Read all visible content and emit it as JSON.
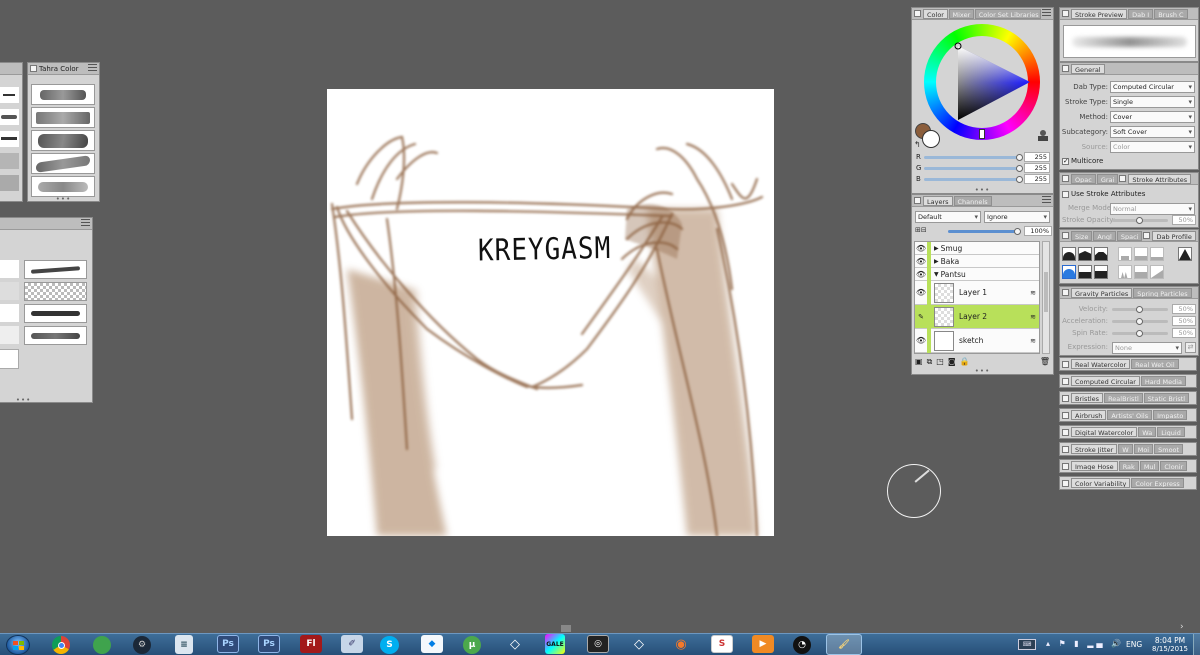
{
  "left_panels": {
    "palette_title": "Tahra Color"
  },
  "canvas": {
    "sketch_text": "KREYGASM"
  },
  "color_panel": {
    "tabs": [
      "Color",
      "Mixer",
      "Color Set Libraries"
    ],
    "rgb": [
      {
        "label": "R",
        "value": "255"
      },
      {
        "label": "G",
        "value": "255"
      },
      {
        "label": "B",
        "value": "255"
      }
    ],
    "current_color": "#8b5e3c",
    "secondary_color": "#ffffff"
  },
  "layers_panel": {
    "tabs": [
      "Layers",
      "Channels"
    ],
    "blend_mode": "Default",
    "lock_mode": "Ignore",
    "opacity": "100%",
    "groups": [
      {
        "name": "Smug",
        "expanded": false
      },
      {
        "name": "Baka",
        "expanded": false
      },
      {
        "name": "Pantsu",
        "expanded": true
      }
    ],
    "layers": [
      {
        "name": "Layer 1",
        "selected": false
      },
      {
        "name": "Layer 2",
        "selected": true
      },
      {
        "name": "sketch",
        "selected": false
      }
    ]
  },
  "brush_panel": {
    "tabs": [
      "Stroke Preview",
      "Dab Profile",
      "Brush Collection"
    ],
    "tab_labels": [
      "Stroke Preview",
      "Dab I",
      "Brush C"
    ],
    "general": {
      "title": "General",
      "fields": [
        {
          "label": "Dab Type:",
          "value": "Computed Circular",
          "disabled": false
        },
        {
          "label": "Stroke Type:",
          "value": "Single",
          "disabled": false
        },
        {
          "label": "Method:",
          "value": "Cover",
          "disabled": false
        },
        {
          "label": "Subcategory:",
          "value": "Soft Cover",
          "disabled": false
        },
        {
          "label": "Source:",
          "value": "Color",
          "disabled": true
        }
      ],
      "multicore": "Multicore"
    },
    "stroke_attr": {
      "tabs": [
        "Opac",
        "Grai",
        "Stroke Attributes"
      ],
      "use_label": "Use Stroke Attributes",
      "merge_label": "Merge Mode:",
      "merge_value": "Normal",
      "opacity_label": "Stroke Opacity:",
      "opacity_value": "50%"
    },
    "dab_profile": {
      "tabs": [
        "Size",
        "Angl",
        "Spaci",
        "Dab Profile"
      ]
    },
    "gravity": {
      "tabs": [
        "Gravity Particles",
        "Spring Particles"
      ],
      "rows": [
        {
          "label": "Velocity:",
          "value": "50%"
        },
        {
          "label": "Acceleration:",
          "value": "50%"
        },
        {
          "label": "Spin Rate:",
          "value": "50%"
        }
      ],
      "expression_label": "Expression:",
      "expression_value": "None"
    },
    "collapsed": [
      {
        "a": "Real Watercolor",
        "b": "Real Wet Oil"
      },
      {
        "a": "Computed Circular",
        "b": "Hard Media"
      },
      {
        "a": "Bristles",
        "b": "RealBristl",
        "c": "Static Bristl"
      },
      {
        "a": "Airbrush",
        "b": "Artists' Oils",
        "c": "Impasto"
      },
      {
        "a": "Digital Watercolor",
        "b": "Wa",
        "c": "Liquid"
      },
      {
        "a": "Stroke Jitter",
        "b": "W",
        "c": "Moi",
        "d": "Smoot"
      },
      {
        "a": "Image Hose",
        "b": "Rak",
        "c": "Mul",
        "d": "Clonir"
      },
      {
        "a": "Color Variability",
        "b": "Color Express"
      }
    ]
  },
  "taskbar": {
    "time": "8:04 PM",
    "date": "8/15/2015",
    "language": "ENG",
    "apps": [
      {
        "id": "chrome-icon",
        "label": ""
      },
      {
        "id": "app-green-icon",
        "label": ""
      },
      {
        "id": "steam-icon",
        "label": ""
      },
      {
        "id": "app-doc-icon",
        "label": ""
      },
      {
        "id": "photoshop-icon",
        "label": "Ps"
      },
      {
        "id": "photoshop2-icon",
        "label": "Ps"
      },
      {
        "id": "flash-icon",
        "label": "Fl"
      },
      {
        "id": "app-brush-icon",
        "label": ""
      },
      {
        "id": "skype-icon",
        "label": "S"
      },
      {
        "id": "dropbox-icon",
        "label": ""
      },
      {
        "id": "utorrent-icon",
        "label": "µ"
      },
      {
        "id": "unity-icon",
        "label": ""
      },
      {
        "id": "gale-icon",
        "label": ""
      },
      {
        "id": "app-dark-icon",
        "label": ""
      },
      {
        "id": "unity2-icon",
        "label": ""
      },
      {
        "id": "blender-icon",
        "label": ""
      },
      {
        "id": "slides-icon",
        "label": "S"
      },
      {
        "id": "player-icon",
        "label": ""
      },
      {
        "id": "obs-icon",
        "label": ""
      },
      {
        "id": "painter-icon",
        "label": ""
      }
    ]
  },
  "colors": {
    "background": "#5c5c5c",
    "accent_green": "#b8e05a",
    "sketch_brown": "#8b5e3c",
    "slider_blue": "#5b8fd0"
  }
}
